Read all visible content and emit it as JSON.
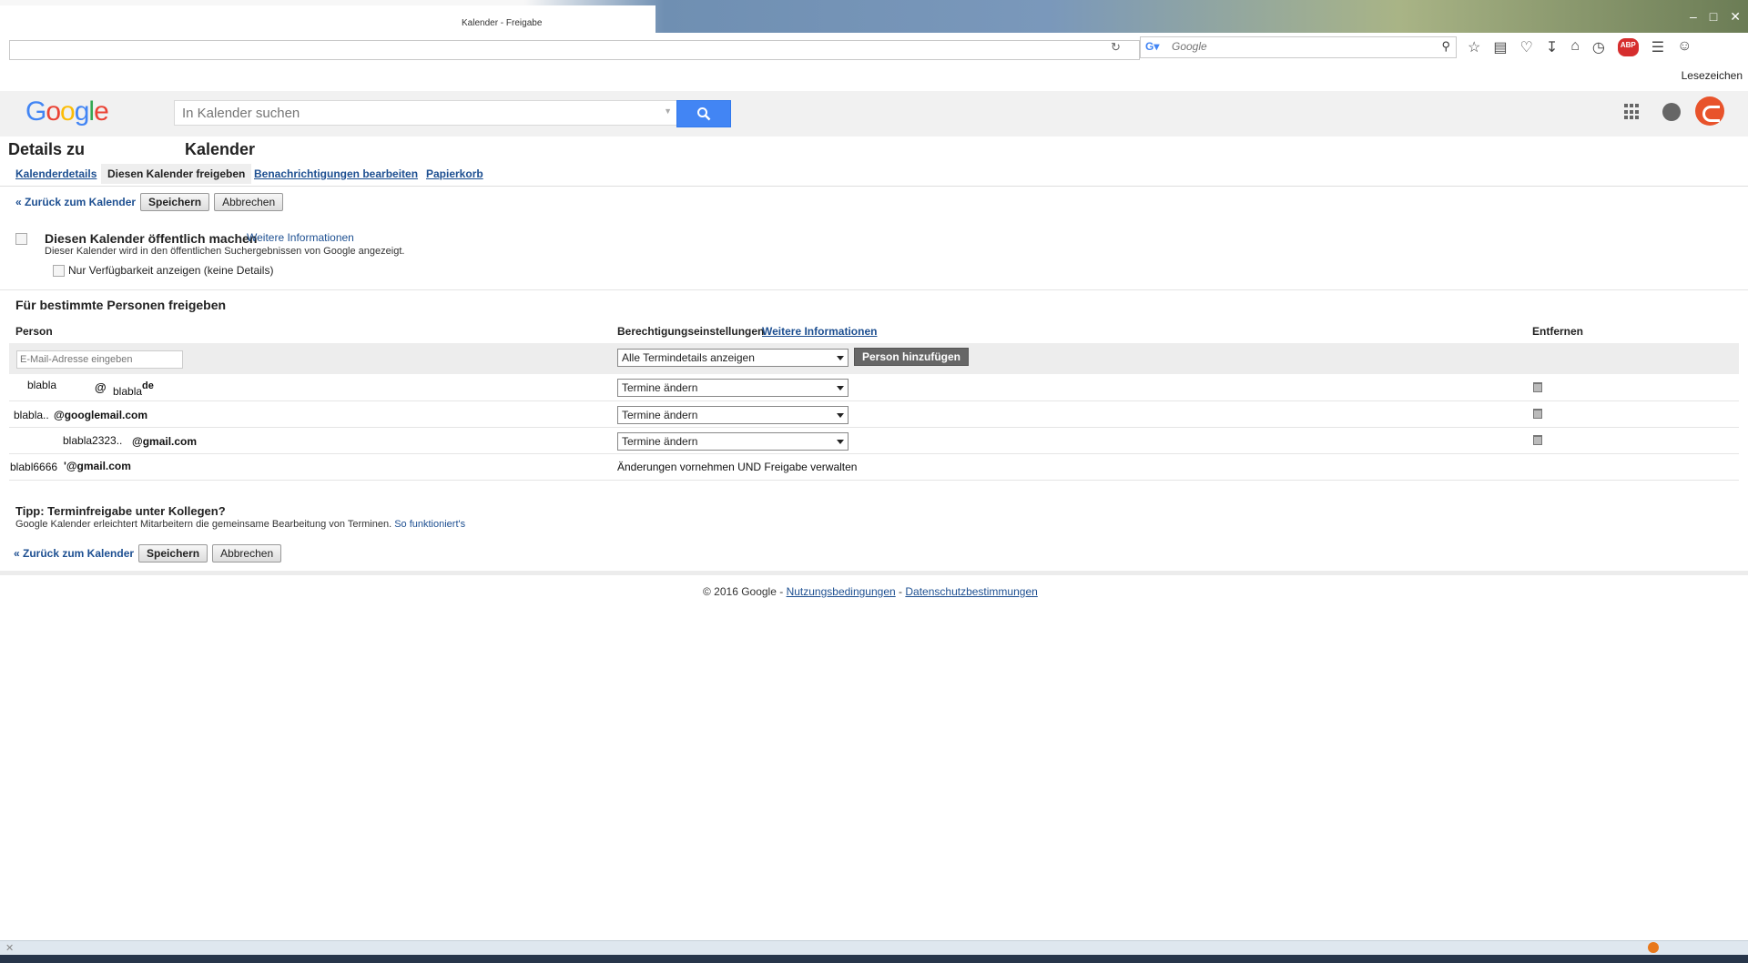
{
  "browser": {
    "search_placeholder": "Google",
    "bookmarks_label": "Lesezeichen",
    "tab_fragments": [
      "Kalender - Freigabe"
    ]
  },
  "header": {
    "logo_text": "Google",
    "search_placeholder": "In Kalender suchen"
  },
  "page": {
    "title_prefix": "Details zu",
    "title_suffix": "Kalender"
  },
  "tabs": [
    {
      "label": "Kalenderdetails"
    },
    {
      "label": "Diesen Kalender freigeben",
      "active": true
    },
    {
      "label": "Benachrichtigungen bearbeiten"
    },
    {
      "label": "Papierkorb"
    }
  ],
  "actions": {
    "back_label": "« Zurück zum Kalender",
    "save_label": "Speichern",
    "cancel_label": "Abbrechen"
  },
  "public": {
    "label": "Diesen Kalender öffentlich machen",
    "more_info": "Weitere Informationen",
    "description": "Dieser Kalender wird in den öffentlichen Suchergebnissen von Google angezeigt.",
    "availability_label": "Nur Verfügbarkeit anzeigen (keine Details)"
  },
  "sharing": {
    "heading": "Für bestimmte Personen freigeben",
    "col_person": "Person",
    "col_permissions": "Berechtigungseinstellungen",
    "col_permissions_link": "Weitere Informationen",
    "col_remove": "Entfernen",
    "email_placeholder": "E-Mail-Adresse eingeben",
    "default_permission": "Alle Termindetails anzeigen",
    "add_person_label": "Person hinzufügen",
    "rows": [
      {
        "person_a": "blabla",
        "person_b": "@",
        "person_c": "blabla",
        "person_d": "de",
        "permission": "Termine ändern",
        "removable": true
      },
      {
        "person_a": "blabla..",
        "person_b": "@googlemail.com",
        "permission": "Termine ändern",
        "removable": true
      },
      {
        "person_a": "blabla2323..",
        "person_b": "@gmail.com",
        "permission": "Termine ändern",
        "removable": true
      },
      {
        "person_a": "blabl6666",
        "person_b": "'@gmail.com",
        "permission": "Änderungen vornehmen UND Freigabe verwalten",
        "removable": false
      }
    ]
  },
  "tip": {
    "title": "Tipp: Terminfreigabe unter Kollegen?",
    "text": "Google Kalender erleichtert Mitarbeitern die gemeinsame Bearbeitung von Terminen.",
    "link": "So funktioniert's"
  },
  "footer": {
    "copyright": "© 2016 Google -",
    "terms": "Nutzungsbedingungen",
    "sep": "-",
    "privacy": "Datenschutzbestimmungen"
  },
  "colors": {
    "link": "#1d4f91",
    "search_button": "#4285f4",
    "avatar": "#e8532b"
  }
}
